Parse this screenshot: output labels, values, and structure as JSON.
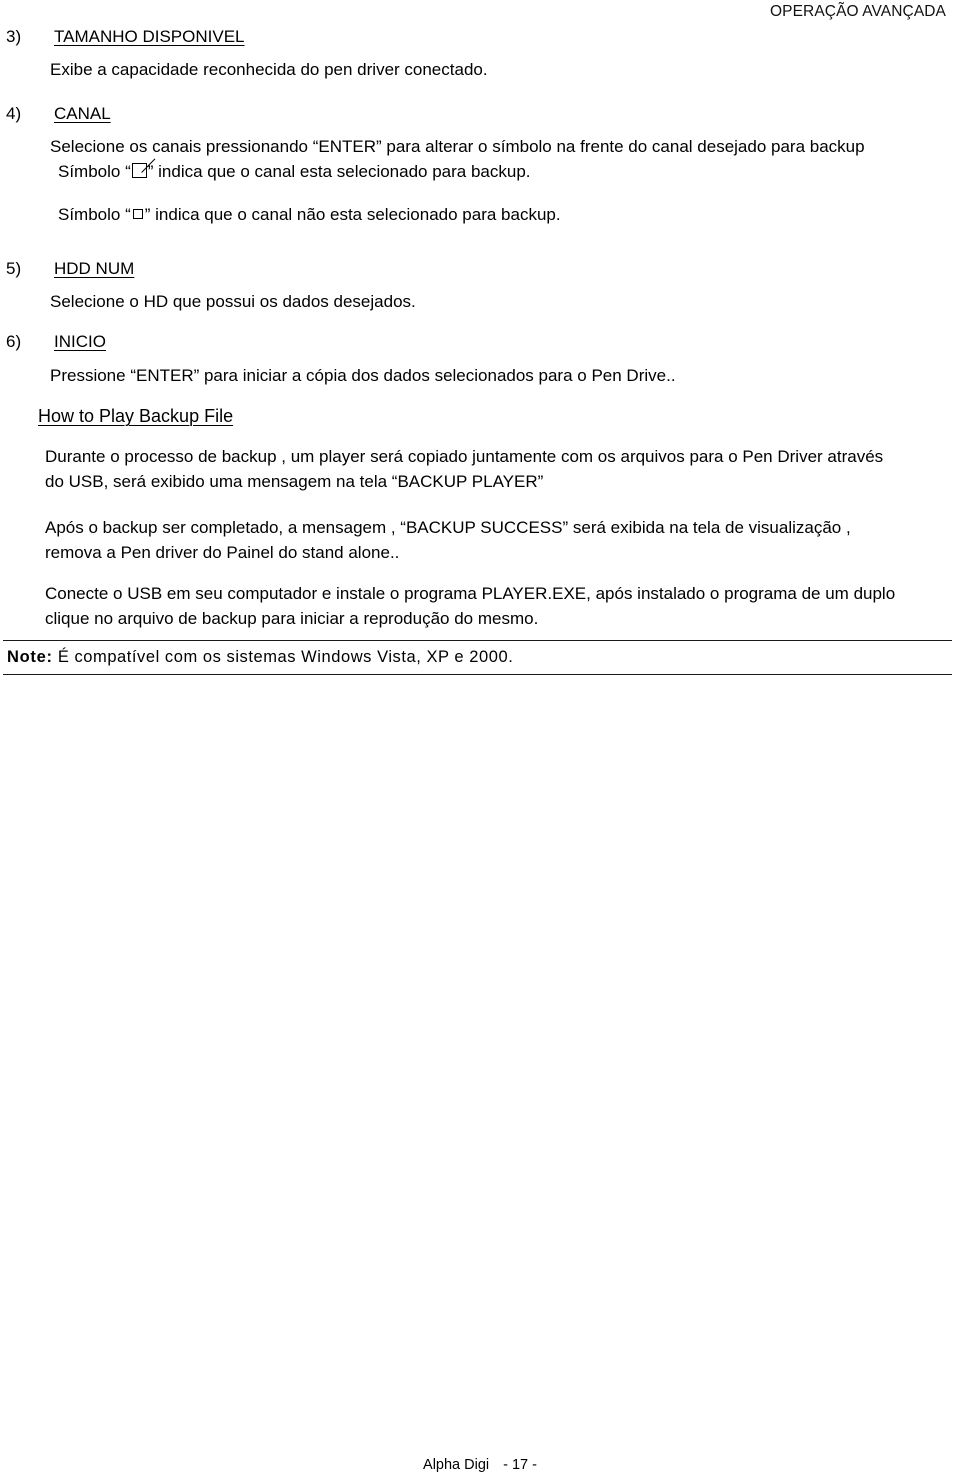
{
  "header": {
    "running_title": "OPERAÇÃO AVANÇADA"
  },
  "sections": [
    {
      "marker": "3)",
      "title": "TAMANHO DISPONIVEL",
      "lines": [
        "Exibe a capacidade reconhecida do pen driver conectado."
      ]
    },
    {
      "marker": "4)",
      "title": "CANAL",
      "lines": [
        "Selecione os canais pressionando “ENTER” para alterar o símbolo na frente do canal desejado para backup"
      ],
      "symbol_checked_prefix": "Símbolo “",
      "symbol_checked_suffix": "” indica que o canal esta selecionado para backup.",
      "symbol_unchecked_prefix": "Símbolo “",
      "symbol_unchecked_suffix": "” indica que o canal não esta selecionado para backup.",
      "icon_checked": "checkbox-checked-icon",
      "icon_unchecked": "checkbox-empty-icon"
    },
    {
      "marker": "5)",
      "title": "HDD NUM",
      "lines": [
        "Selecione o HD que possui os dados desejados."
      ]
    },
    {
      "marker": "6)",
      "title": "INICIO",
      "lines": [
        "Pressione “ENTER” para iniciar a cópia dos dados selecionados para o Pen Drive.."
      ]
    }
  ],
  "subsection": {
    "title": "How to Play Backup File",
    "paragraphs": [
      [
        "Durante o processo de backup , um player será copiado juntamente com os arquivos para o Pen Driver através",
        "do USB, será exibido uma mensagem na tela “BACKUP PLAYER”"
      ],
      [
        "Após o backup ser completado, a mensagem , “BACKUP SUCCESS” será exibida na tela de visualização ,",
        "remova a Pen driver do Painel do stand alone.."
      ],
      [
        "Conecte o USB em seu computador e instale o programa PLAYER.EXE, após instalado o programa de um duplo",
        "clique no arquivo de backup para iniciar a reprodução do mesmo."
      ]
    ]
  },
  "note": {
    "label": "Note:",
    "text": "É compatível com os sistemas Windows Vista, XP e 2000."
  },
  "footer": {
    "brand": "Alpha Digi",
    "page_number": "- 17 -"
  },
  "colors": {
    "text": "#000000",
    "rule": "#1a1a1a",
    "background": "#ffffff"
  }
}
